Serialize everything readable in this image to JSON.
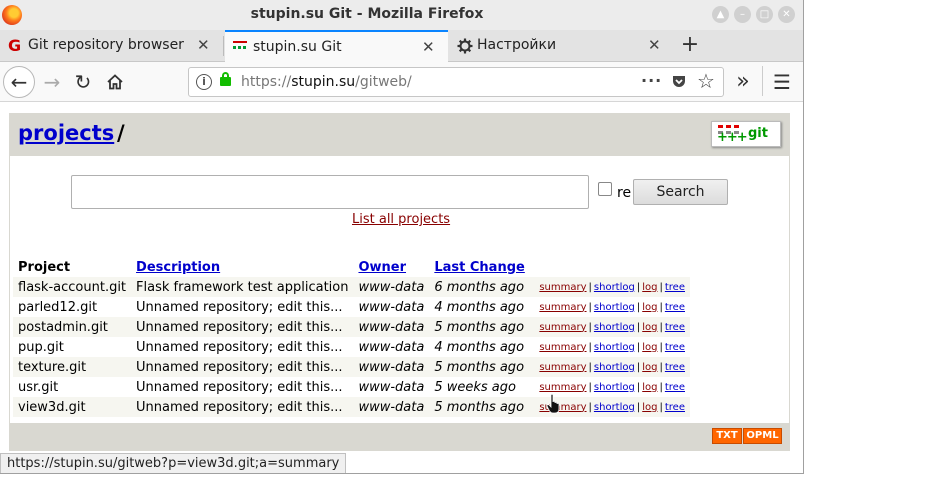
{
  "window": {
    "title": "stupin.su Git - Mozilla Firefox",
    "controls": [
      "up",
      "minimize",
      "maximize",
      "close"
    ]
  },
  "tabs": [
    {
      "label": "Git repository browser",
      "icon": "git-favicon",
      "active": false
    },
    {
      "label": "stupin.su Git",
      "icon": "gitweb-favicon",
      "active": true
    },
    {
      "label": "Настройки",
      "icon": "gear-icon",
      "active": false
    }
  ],
  "navbar": {
    "url_scheme": "https://",
    "url_host": "stupin.su",
    "url_path": "/gitweb/"
  },
  "page": {
    "breadcrumb_link": "projects",
    "breadcrumb_sep": "/",
    "logo_text": "git",
    "search_value": "",
    "re_label": "re",
    "search_button": "Search",
    "list_all_link": "List all projects"
  },
  "table": {
    "headers": [
      "Project",
      "Description",
      "Owner",
      "Last Change"
    ],
    "link_labels": {
      "summary": "summary",
      "shortlog": "shortlog",
      "log": "log",
      "tree": "tree"
    },
    "rows": [
      {
        "project": "flask-account.git",
        "description": "Flask framework test application",
        "owner": "www-data",
        "last_change": "6 months ago"
      },
      {
        "project": "parled12.git",
        "description": "Unnamed repository; edit this...",
        "owner": "www-data",
        "last_change": "4 months ago"
      },
      {
        "project": "postadmin.git",
        "description": "Unnamed repository; edit this...",
        "owner": "www-data",
        "last_change": "5 months ago"
      },
      {
        "project": "pup.git",
        "description": "Unnamed repository; edit this...",
        "owner": "www-data",
        "last_change": "4 months ago"
      },
      {
        "project": "texture.git",
        "description": "Unnamed repository; edit this...",
        "owner": "www-data",
        "last_change": "5 months ago"
      },
      {
        "project": "usr.git",
        "description": "Unnamed repository; edit this...",
        "owner": "www-data",
        "last_change": "5 weeks ago"
      },
      {
        "project": "view3d.git",
        "description": "Unnamed repository; edit this...",
        "owner": "www-data",
        "last_change": "5 months ago"
      }
    ]
  },
  "footer": {
    "txt_label": "TXT",
    "opml_label": "OPML"
  },
  "statusbar": {
    "text": "https://stupin.su/gitweb?p=view3d.git;a=summary"
  },
  "colors": {
    "header_bg": "#d9d8d1",
    "link_blue": "#0000cc",
    "link_red": "#880000",
    "feed_orange": "#ff6600",
    "active_tab_accent": "#0a84ff"
  }
}
